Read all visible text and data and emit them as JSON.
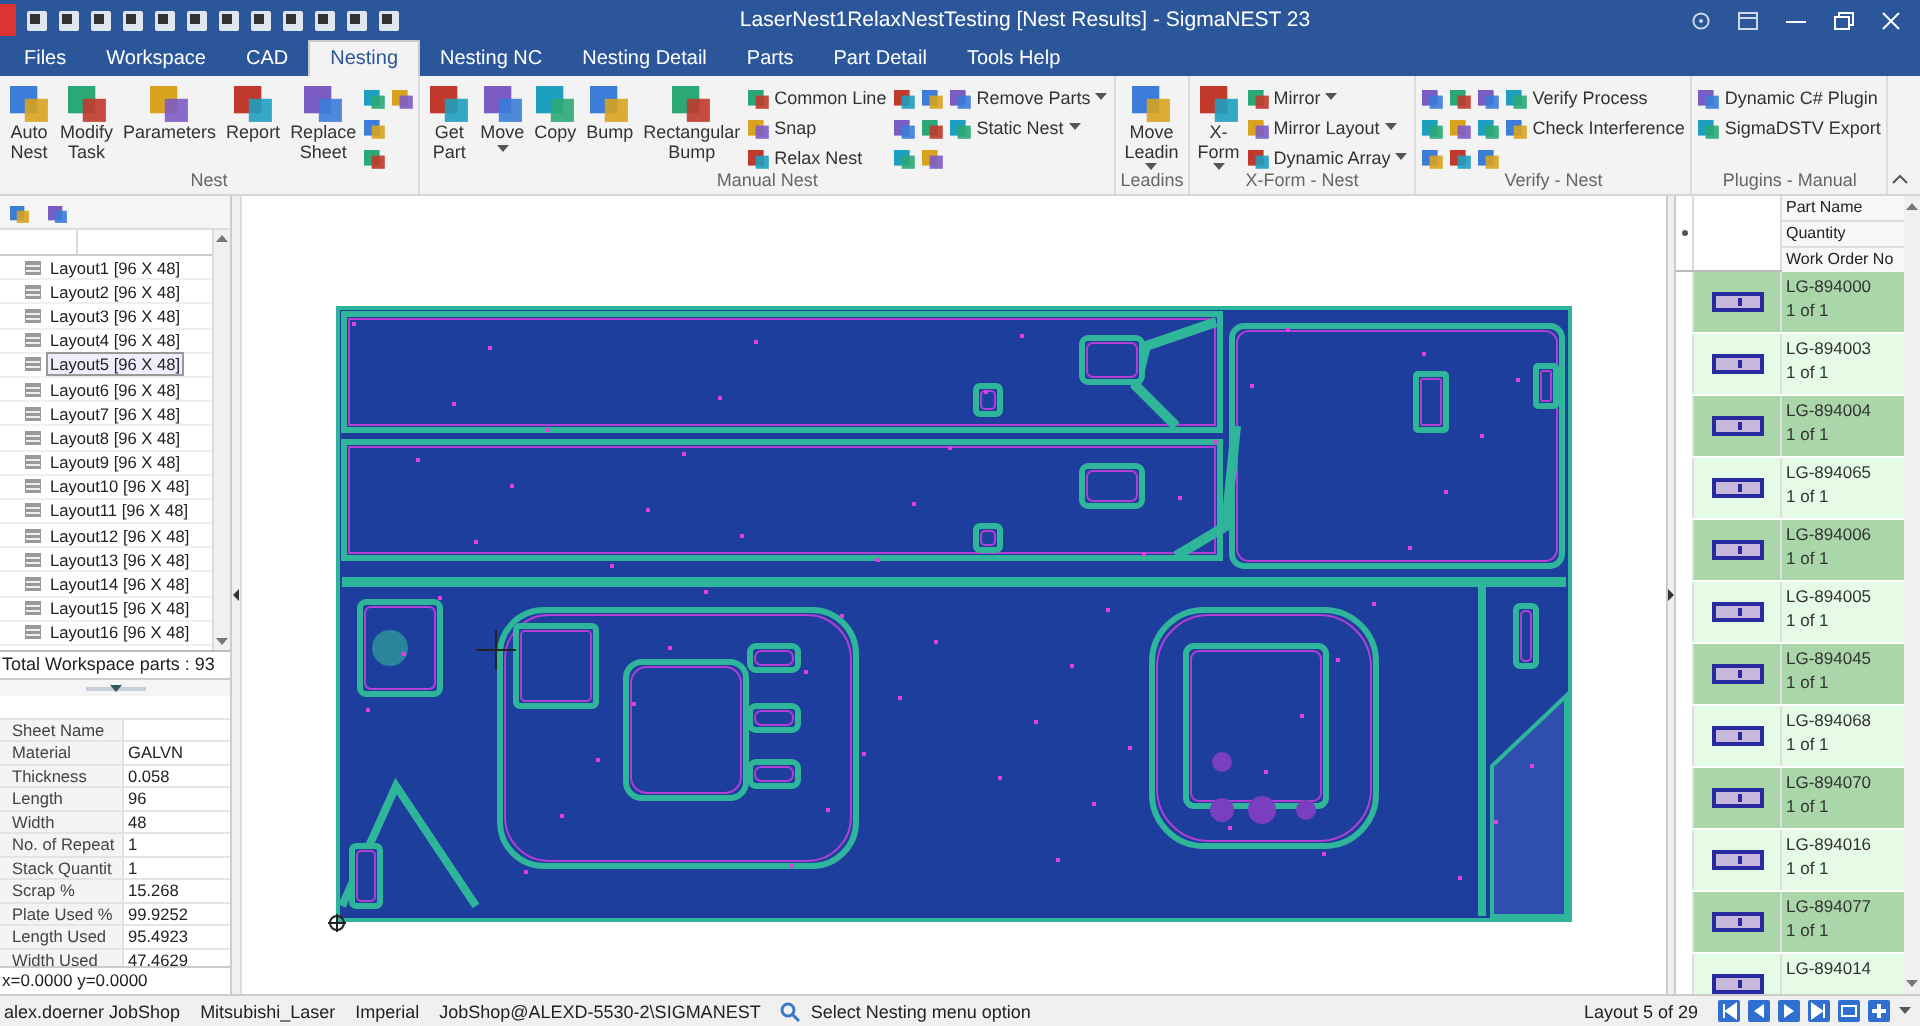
{
  "window": {
    "title": "LaserNest1RelaxNestTesting [Nest Results] - SigmaNEST 23"
  },
  "tabs": [
    {
      "label": "Files",
      "selected": false
    },
    {
      "label": "Workspace",
      "selected": false
    },
    {
      "label": "CAD",
      "selected": false
    },
    {
      "label": "Nesting",
      "selected": true
    },
    {
      "label": "Nesting NC",
      "selected": false
    },
    {
      "label": "Nesting Detail",
      "selected": false
    },
    {
      "label": "Parts",
      "selected": false
    },
    {
      "label": "Part Detail",
      "selected": false
    },
    {
      "label": "Tools Help",
      "selected": false
    }
  ],
  "ribbon": {
    "groups": [
      {
        "label": "Nest",
        "items": [
          {
            "kind": "large",
            "label": "Auto Nest",
            "dropdown": false
          },
          {
            "kind": "large",
            "label": "Modify Task",
            "dropdown": false
          },
          {
            "kind": "large",
            "label": "Parameters",
            "dropdown": false
          },
          {
            "kind": "large",
            "label": "Report",
            "dropdown": false
          },
          {
            "kind": "large",
            "label": "Replace Sheet",
            "dropdown": false
          },
          {
            "kind": "icon"
          },
          {
            "kind": "icon"
          },
          {
            "kind": "icon"
          },
          {
            "kind": "icon"
          }
        ]
      },
      {
        "label": "Manual Nest",
        "items": [
          {
            "kind": "large",
            "label": "Get Part",
            "dropdown": false
          },
          {
            "kind": "large",
            "label": "Move",
            "dropdown": true
          },
          {
            "kind": "large",
            "label": "Copy",
            "dropdown": false
          },
          {
            "kind": "large",
            "label": "Bump",
            "dropdown": false
          },
          {
            "kind": "large",
            "label": "Rectangular Bump",
            "dropdown": false
          },
          {
            "kind": "small",
            "label": "Common Line",
            "dropdown": false
          },
          {
            "kind": "small",
            "label": "Snap",
            "dropdown": false
          },
          {
            "kind": "small",
            "label": "Relax Nest",
            "dropdown": false
          },
          {
            "kind": "icon"
          },
          {
            "kind": "icon"
          },
          {
            "kind": "icon"
          },
          {
            "kind": "icon"
          },
          {
            "kind": "icon"
          },
          {
            "kind": "icon"
          },
          {
            "kind": "small",
            "label": "Remove Parts",
            "dropdown": true
          },
          {
            "kind": "small",
            "label": "Static Nest",
            "dropdown": true
          }
        ]
      },
      {
        "label": "Leadins",
        "items": [
          {
            "kind": "large",
            "label": "Move Leadin",
            "dropdown": true
          }
        ]
      },
      {
        "label": "X-Form - Nest",
        "items": [
          {
            "kind": "large",
            "label": "X-Form",
            "dropdown": true
          },
          {
            "kind": "small",
            "label": "Mirror",
            "dropdown": true
          },
          {
            "kind": "small",
            "label": "Mirror Layout",
            "dropdown": true
          },
          {
            "kind": "small",
            "label": "Dynamic Array",
            "dropdown": true
          }
        ]
      },
      {
        "label": "Verify - Nest",
        "items": [
          {
            "kind": "icon"
          },
          {
            "kind": "icon"
          },
          {
            "kind": "icon"
          },
          {
            "kind": "icon"
          },
          {
            "kind": "icon"
          },
          {
            "kind": "icon"
          },
          {
            "kind": "icon"
          },
          {
            "kind": "icon"
          },
          {
            "kind": "icon"
          },
          {
            "kind": "small",
            "label": "Verify Process",
            "dropdown": false
          },
          {
            "kind": "small",
            "label": "Check Interference",
            "dropdown": false
          }
        ]
      },
      {
        "label": "Plugins - Manual",
        "items": [
          {
            "kind": "small",
            "label": "Dynamic C# Plugin",
            "dropdown": false
          },
          {
            "kind": "small",
            "label": "SigmaDSTV Export",
            "dropdown": false
          }
        ]
      }
    ]
  },
  "layouts": [
    {
      "label": "Layout1 [96 X 48]",
      "selected": false
    },
    {
      "label": "Layout2 [96 X 48]",
      "selected": false
    },
    {
      "label": "Layout3 [96 X 48]",
      "selected": false
    },
    {
      "label": "Layout4 [96 X 48]",
      "selected": false
    },
    {
      "label": "Layout5 [96 X 48]",
      "selected": true
    },
    {
      "label": "Layout6 [96 X 48]",
      "selected": false
    },
    {
      "label": "Layout7 [96 X 48]",
      "selected": false
    },
    {
      "label": "Layout8 [96 X 48]",
      "selected": false
    },
    {
      "label": "Layout9 [96 X 48]",
      "selected": false
    },
    {
      "label": "Layout10 [96 X 48]",
      "selected": false
    },
    {
      "label": "Layout11 [96 X 48]",
      "selected": false
    },
    {
      "label": "Layout12 [96 X 48]",
      "selected": false
    },
    {
      "label": "Layout13 [96 X 48]",
      "selected": false
    },
    {
      "label": "Layout14 [96 X 48]",
      "selected": false
    },
    {
      "label": "Layout15 [96 X 48]",
      "selected": false
    },
    {
      "label": "Layout16 [96 X 48]",
      "selected": false
    }
  ],
  "total_parts": "Total Workspace parts : 93",
  "properties": [
    {
      "name": "Sheet Name"
    },
    {
      "name": "Material",
      "value": "GALVN"
    },
    {
      "name": "Thickness",
      "value": "0.058"
    },
    {
      "name": "Length",
      "value": "96"
    },
    {
      "name": "Width",
      "value": "48"
    },
    {
      "name": "No. of Repeat",
      "value": "1"
    },
    {
      "name": "Stack Quantit",
      "value": "1"
    },
    {
      "name": "Scrap %",
      "value": "15.268"
    },
    {
      "name": "Plate Used %",
      "value": "99.9252"
    },
    {
      "name": "Length Used",
      "value": "95.4923"
    },
    {
      "name": "Width Used",
      "value": "47.4629"
    }
  ],
  "coordinates": "x=0.0000 y=0.0000",
  "parts": {
    "columns": [
      "Part Name",
      "Quantity",
      "Work Order No"
    ],
    "rows": [
      {
        "name": "LG-894000",
        "quantity": "1 of 1"
      },
      {
        "name": "LG-894003",
        "quantity": "1 of 1"
      },
      {
        "name": "LG-894004",
        "quantity": "1 of 1"
      },
      {
        "name": "LG-894065",
        "quantity": "1 of 1"
      },
      {
        "name": "LG-894006",
        "quantity": "1 of 1"
      },
      {
        "name": "LG-894005",
        "quantity": "1 of 1"
      },
      {
        "name": "LG-894045",
        "quantity": "1 of 1"
      },
      {
        "name": "LG-894068",
        "quantity": "1 of 1"
      },
      {
        "name": "LG-894070",
        "quantity": "1 of 1"
      },
      {
        "name": "LG-894016",
        "quantity": "1 of 1"
      },
      {
        "name": "LG-894077",
        "quantity": "1 of 1"
      },
      {
        "name": "LG-894014"
      }
    ]
  },
  "status_bar": {
    "items": [
      "alex.doerner JobShop",
      "Mitsubishi_Laser",
      "Imperial",
      "JobShop@ALEXD-5530-2\\SIGMANEST"
    ],
    "message": "Select Nesting menu option",
    "page": "Layout 5 of 29"
  }
}
